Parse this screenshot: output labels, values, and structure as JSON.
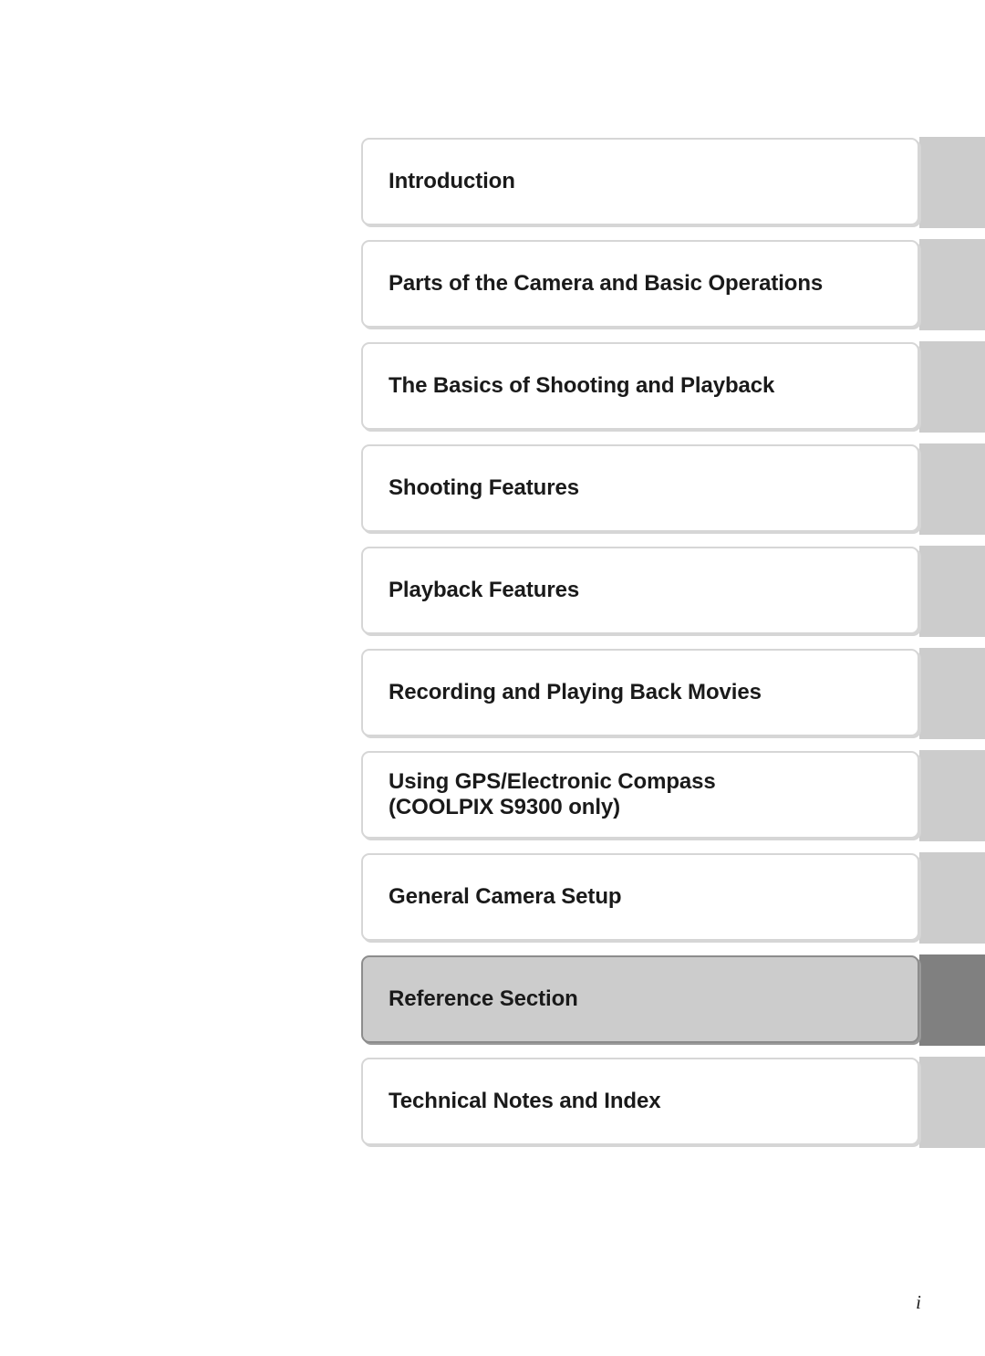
{
  "page": {
    "folio": "i",
    "colors": {
      "tab_default": "#cccccc",
      "tab_active": "#808080",
      "box_default_fill": "#ffffff",
      "box_active_fill": "#cccccc",
      "box_default_border": "#d6d6d6",
      "box_active_border": "#8c8c8c",
      "text": "#1a1a1a",
      "background": "#ffffff"
    }
  },
  "chapters": [
    {
      "label": "Introduction",
      "active": false
    },
    {
      "label": "Parts of the Camera and Basic Operations",
      "active": false
    },
    {
      "label": "The Basics of Shooting and Playback",
      "active": false
    },
    {
      "label": "Shooting Features",
      "active": false
    },
    {
      "label": "Playback Features",
      "active": false
    },
    {
      "label": "Recording and Playing Back Movies",
      "active": false
    },
    {
      "label": "Using GPS/Electronic Compass\n(COOLPIX S9300 only)",
      "active": false
    },
    {
      "label": "General Camera Setup",
      "active": false
    },
    {
      "label": "Reference Section",
      "active": true
    },
    {
      "label": "Technical Notes and Index",
      "active": false
    }
  ]
}
